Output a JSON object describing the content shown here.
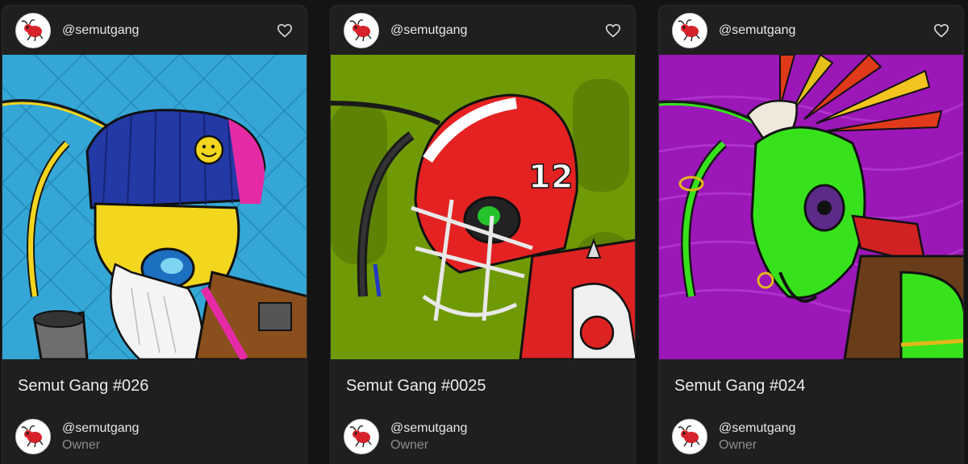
{
  "cards": [
    {
      "creator": "@semutgang",
      "title": "Semut Gang #026",
      "owner": "@semutgang",
      "owner_role": "Owner",
      "art_bg": "#34a7d6",
      "art_name": "ant-with-beanie-and-beard-artwork"
    },
    {
      "creator": "@semutgang",
      "title": "Semut Gang #0025",
      "owner": "@semutgang",
      "owner_role": "Owner",
      "art_bg": "#6f9a06",
      "art_name": "ant-with-football-helmet-artwork"
    },
    {
      "creator": "@semutgang",
      "title": "Semut Gang #024",
      "owner": "@semutgang",
      "owner_role": "Owner",
      "art_bg": "#9b17b8",
      "art_name": "ant-with-feather-headdress-artwork"
    }
  ],
  "icons": {
    "like": "heart-outline-icon",
    "avatar": "red-ant-logo"
  },
  "colors": {
    "page_bg": "#141414",
    "card_bg": "#1f1f1f",
    "secondary_text": "#8d8d8d"
  }
}
